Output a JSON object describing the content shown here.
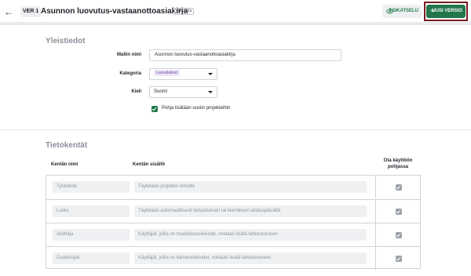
{
  "header": {
    "version": "VER 1",
    "title": "Asunnon luovutus-vastaanottoasiakirja",
    "status_badge": "Julkaistu",
    "preview_label": "ESIKATSELU",
    "new_version_label": "UUSI VERSIO"
  },
  "general": {
    "section_title": "Yleistiedot",
    "template_name_label": "Mallin nimi",
    "template_name_value": "Asunnon luovutus-vastaanottoasiakirja",
    "category_label": "Kategoria",
    "category_value": "Luovutukset",
    "language_label": "Kieli",
    "language_value": "Suomi",
    "auto_add_label": "Pohja lisätään uusiin projekteihin",
    "auto_add_checked": true
  },
  "fields": {
    "section_title": "Tietokentät",
    "col_name": "Kentän nimi",
    "col_content": "Kentän sisältö",
    "col_enabled_line1": "Ota käyttöön",
    "col_enabled_line2": "pohjassa",
    "rows": [
      {
        "name": "Työkohde",
        "content": "Täytetään projektin nimellä",
        "enabled": true
      },
      {
        "name": "Luotu",
        "content": "Täytetään automaattisesti tarkastuksen tai kierroksen aloituspäivällä",
        "enabled": true
      },
      {
        "name": "Aloittaja",
        "content": "Käyttäjät, joilla on muokkausoikeudet, voidaan lisätä tarkastukseen",
        "enabled": true
      },
      {
        "name": "Osallistujat",
        "content": "Käyttäjät, joilla on katseluoikeudet, voidaan lisätä tarkastukseen",
        "enabled": true
      }
    ]
  },
  "colors": {
    "primary_green": "#23764a",
    "highlight_border": "#7a1d1d",
    "tag_bg": "#ece5f6",
    "tag_text": "#6b3fa0"
  }
}
